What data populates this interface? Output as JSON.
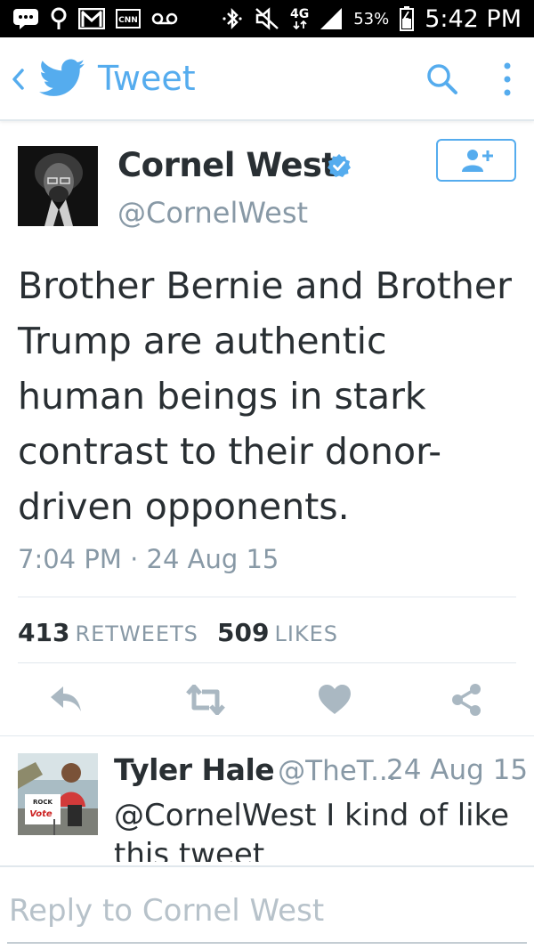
{
  "status_bar": {
    "network_label": "4G",
    "battery_percent": "53%",
    "time": "5:42 PM",
    "icons": [
      "chat-icon",
      "location-icon",
      "gmail-icon",
      "cnn-icon",
      "voicemail-icon",
      "bluetooth-icon",
      "mute-icon",
      "network-4g-icon",
      "signal-icon",
      "battery-icon"
    ]
  },
  "header": {
    "title": "Tweet",
    "colors": {
      "accent": "#55acee"
    }
  },
  "tweet": {
    "author_name": "Cornel West",
    "author_handle": "@CornelWest",
    "verified": true,
    "text_lines": [
      "Brother Bernie and Brother",
      "Trump are authentic",
      "human beings in stark",
      "contrast to their donor-",
      "driven opponents."
    ],
    "timestamp": "7:04 PM · 24 Aug 15",
    "retweets_count": "413",
    "retweets_label": "RETWEETS",
    "likes_count": "509",
    "likes_label": "LIKES"
  },
  "actions": [
    "reply-icon",
    "retweet-icon",
    "like-icon",
    "share-icon"
  ],
  "reply": {
    "name": "Tyler Hale",
    "handle": "@TheT...",
    "date": "24 Aug 15",
    "text_lines": [
      "@CornelWest I kind of like",
      "this tweet"
    ],
    "avatar_sign_text": "Vote"
  },
  "composer": {
    "placeholder": "Reply to Cornel West"
  },
  "colors": {
    "text": "#292f33",
    "muted": "#8899a6",
    "divider": "#e1e8ed",
    "verified": "#55acee",
    "action_icon": "#aab8c2"
  }
}
